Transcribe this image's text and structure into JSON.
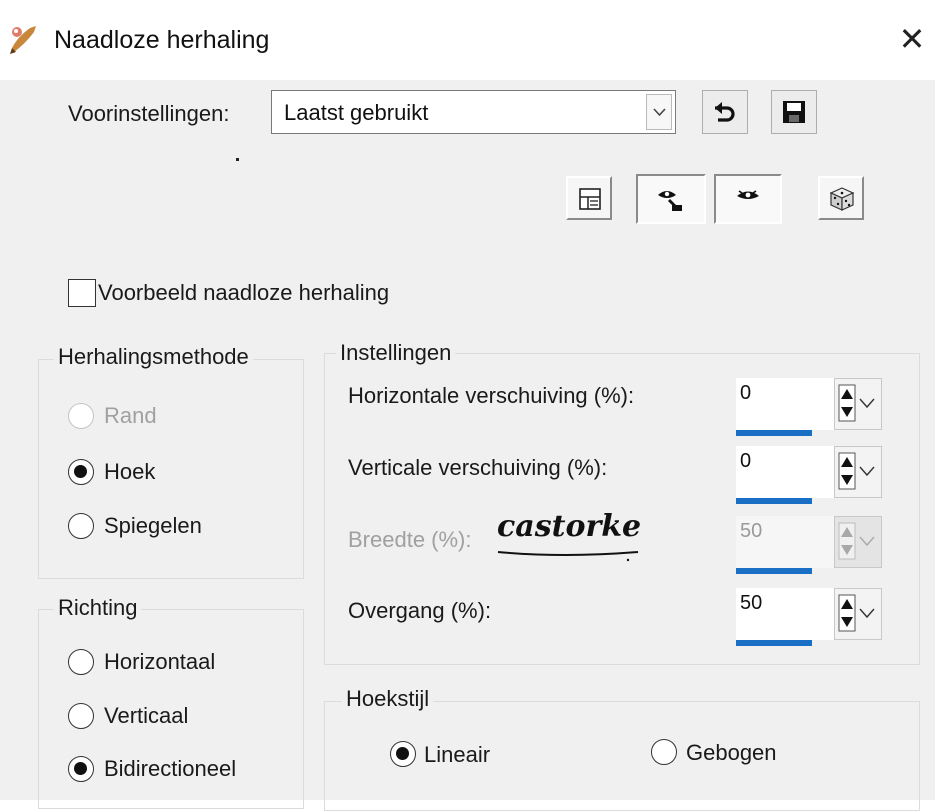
{
  "window": {
    "title": "Naadloze herhaling",
    "close_glyph": "✕",
    "app_icon": "paint-brush-icon"
  },
  "presets": {
    "label": "Voorinstellingen:",
    "value": "Laatst gebruikt",
    "reset_icon": "reset-arrow-icon",
    "save_icon": "save-icon"
  },
  "toolbar": {
    "icons": [
      "layout-icon",
      "proof-eye-icon",
      "auto-proof-eye-icon",
      "randomize-dice-icon"
    ]
  },
  "preview": {
    "label": "Voorbeeld naadloze herhaling",
    "checked": false
  },
  "method": {
    "title": "Herhalingsmethode",
    "options": [
      {
        "label": "Rand",
        "selected": false,
        "disabled": true
      },
      {
        "label": "Hoek",
        "selected": true,
        "disabled": false
      },
      {
        "label": "Spiegelen",
        "selected": false,
        "disabled": false
      }
    ]
  },
  "direction": {
    "title": "Richting",
    "options": [
      {
        "label": "Horizontaal",
        "selected": false
      },
      {
        "label": "Verticaal",
        "selected": false
      },
      {
        "label": "Bidirectioneel",
        "selected": true
      }
    ]
  },
  "settings": {
    "title": "Instellingen",
    "fields": [
      {
        "label": "Horizontale verschuiving (%):",
        "value": "0",
        "disabled": false
      },
      {
        "label": "Verticale verschuiving (%):",
        "value": "0",
        "disabled": false
      },
      {
        "label": "Breedte (%):",
        "value": "50",
        "disabled": true
      },
      {
        "label": "Overgang (%):",
        "value": "50",
        "disabled": false
      }
    ]
  },
  "watermark": {
    "text": "castorke"
  },
  "corner_style": {
    "title": "Hoekstijl",
    "options": [
      {
        "label": "Lineair",
        "selected": true
      },
      {
        "label": "Gebogen",
        "selected": false
      }
    ]
  },
  "colors": {
    "accent": "#1a6fc4",
    "dialog_bg": "#f0f0f0"
  }
}
